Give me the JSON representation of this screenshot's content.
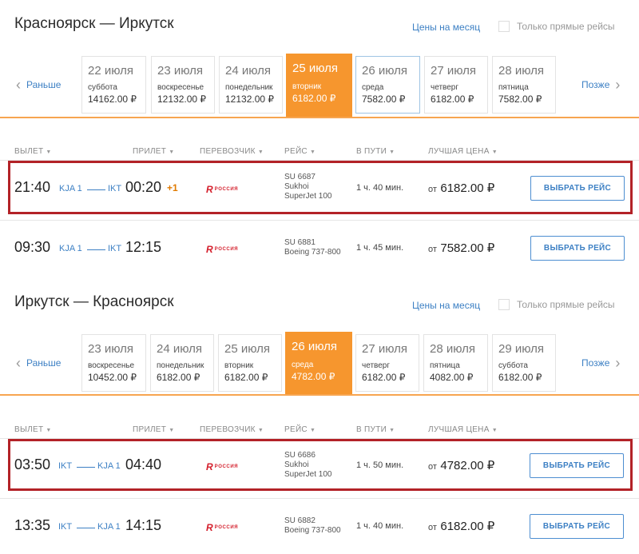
{
  "routes": [
    {
      "title": "Красноярск — Иркутск",
      "month_prices": "Цены на месяц",
      "direct_only": "Только прямые рейсы",
      "prev": "Раньше",
      "next": "Позже",
      "dates": [
        {
          "date": "22 июля",
          "weekday": "суббота",
          "price": "14162.00 ₽"
        },
        {
          "date": "23 июля",
          "weekday": "воскресенье",
          "price": "12132.00 ₽"
        },
        {
          "date": "24 июля",
          "weekday": "понедельник",
          "price": "12132.00 ₽"
        },
        {
          "date": "25 июля",
          "weekday": "вторник",
          "price": "6182.00 ₽",
          "active": true
        },
        {
          "date": "26 июля",
          "weekday": "среда",
          "price": "7582.00 ₽"
        },
        {
          "date": "27 июля",
          "weekday": "четверг",
          "price": "6182.00 ₽"
        },
        {
          "date": "28 июля",
          "weekday": "пятница",
          "price": "7582.00 ₽"
        }
      ],
      "headers": {
        "depart": "ВЫЛЕТ",
        "arrive": "ПРИЛЕТ",
        "carrier": "ПЕРЕВОЗЧИК",
        "flight": "РЕЙС",
        "duration": "В ПУТИ",
        "best_price": "ЛУЧШАЯ ЦЕНА"
      },
      "flights": [
        {
          "dep_time": "21:40",
          "dep_airport": "KJA 1",
          "arr_airport": "IKT",
          "arr_time": "00:20",
          "next_day": "+1",
          "carrier_mark": "R",
          "carrier_name": "РОССИЯ",
          "flight_no": "SU 6687",
          "aircraft": "Sukhoi SuperJet 100",
          "duration": "1 ч. 40 мин.",
          "price_prefix": "от",
          "price": "6182.00 ₽",
          "button": "ВЫБРАТЬ РЕЙС",
          "highlighted": true
        },
        {
          "dep_time": "09:30",
          "dep_airport": "KJA 1",
          "arr_airport": "IKT",
          "arr_time": "12:15",
          "next_day": "",
          "carrier_mark": "R",
          "carrier_name": "РОССИЯ",
          "flight_no": "SU 6881",
          "aircraft": "Boeing 737-800",
          "duration": "1 ч. 45 мин.",
          "price_prefix": "от",
          "price": "7582.00 ₽",
          "button": "ВЫБРАТЬ РЕЙС",
          "highlighted": false
        }
      ]
    },
    {
      "title": "Иркутск — Красноярск",
      "month_prices": "Цены на месяц",
      "direct_only": "Только прямые рейсы",
      "prev": "Раньше",
      "next": "Позже",
      "dates": [
        {
          "date": "23 июля",
          "weekday": "воскресенье",
          "price": "10452.00 ₽"
        },
        {
          "date": "24 июля",
          "weekday": "понедельник",
          "price": "6182.00 ₽"
        },
        {
          "date": "25 июля",
          "weekday": "вторник",
          "price": "6182.00 ₽"
        },
        {
          "date": "26 июля",
          "weekday": "среда",
          "price": "4782.00 ₽",
          "active": true
        },
        {
          "date": "27 июля",
          "weekday": "четверг",
          "price": "6182.00 ₽"
        },
        {
          "date": "28 июля",
          "weekday": "пятница",
          "price": "4082.00 ₽"
        },
        {
          "date": "29 июля",
          "weekday": "суббота",
          "price": "6182.00 ₽"
        }
      ],
      "headers": {
        "depart": "ВЫЛЕТ",
        "arrive": "ПРИЛЕТ",
        "carrier": "ПЕРЕВОЗЧИК",
        "flight": "РЕЙС",
        "duration": "В ПУТИ",
        "best_price": "ЛУЧШАЯ ЦЕНА"
      },
      "flights": [
        {
          "dep_time": "03:50",
          "dep_airport": "IKT",
          "arr_airport": "KJA 1",
          "arr_time": "04:40",
          "next_day": "",
          "carrier_mark": "R",
          "carrier_name": "РОССИЯ",
          "flight_no": "SU 6686",
          "aircraft": "Sukhoi SuperJet 100",
          "duration": "1 ч. 50 мин.",
          "price_prefix": "от",
          "price": "4782.00 ₽",
          "button": "ВЫБРАТЬ РЕЙС",
          "highlighted": true
        },
        {
          "dep_time": "13:35",
          "dep_airport": "IKT",
          "arr_airport": "KJA 1",
          "arr_time": "14:15",
          "next_day": "",
          "carrier_mark": "R",
          "carrier_name": "РОССИЯ",
          "flight_no": "SU 6882",
          "aircraft": "Boeing 737-800",
          "duration": "1 ч. 40 мин.",
          "price_prefix": "от",
          "price": "6182.00 ₽",
          "button": "ВЫБРАТЬ РЕЙС",
          "highlighted": false
        }
      ]
    }
  ]
}
